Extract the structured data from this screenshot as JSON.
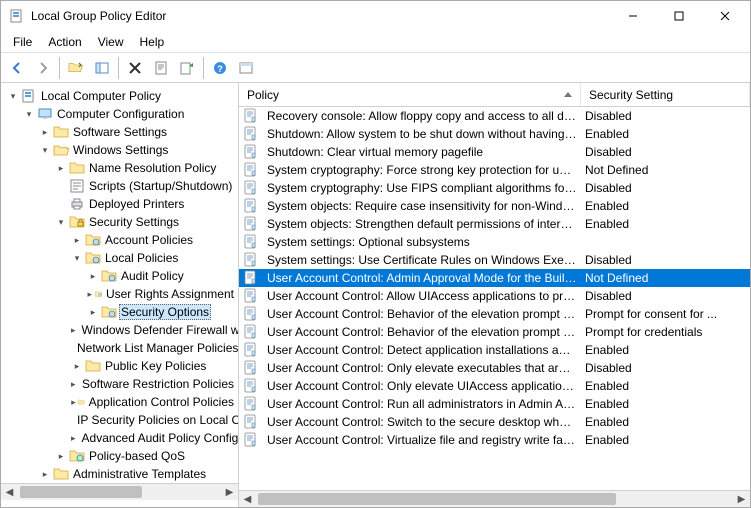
{
  "window": {
    "title": "Local Group Policy Editor",
    "menus": [
      "File",
      "Action",
      "View",
      "Help"
    ]
  },
  "tree": {
    "root": "Local Computer Policy",
    "cc": "Computer Configuration",
    "ss": "Software Settings",
    "ws": "Windows Settings",
    "nrp": "Name Resolution Policy",
    "scr": "Scripts (Startup/Shutdown)",
    "dp": "Deployed Printers",
    "secset": "Security Settings",
    "acct": "Account Policies",
    "local": "Local Policies",
    "audit": "Audit Policy",
    "ura": "User Rights Assignment",
    "seco": "Security Options",
    "wdf": "Windows Defender Firewall with Advanced Security",
    "nlm": "Network List Manager Policies",
    "pkp": "Public Key Policies",
    "srp": "Software Restriction Policies",
    "acp": "Application Control Policies",
    "ips": "IP Security Policies on Local Computer",
    "aap": "Advanced Audit Policy Configuration",
    "qos": "Policy-based QoS",
    "at": "Administrative Templates"
  },
  "columns": {
    "policy": "Policy",
    "setting": "Security Setting"
  },
  "policies": [
    {
      "name": "Recovery console: Allow floppy copy and access to all drives...",
      "setting": "Disabled"
    },
    {
      "name": "Shutdown: Allow system to be shut down without having to...",
      "setting": "Enabled"
    },
    {
      "name": "Shutdown: Clear virtual memory pagefile",
      "setting": "Disabled"
    },
    {
      "name": "System cryptography: Force strong key protection for user k...",
      "setting": "Not Defined"
    },
    {
      "name": "System cryptography: Use FIPS compliant algorithms for en...",
      "setting": "Disabled"
    },
    {
      "name": "System objects: Require case insensitivity for non-Windows ...",
      "setting": "Enabled"
    },
    {
      "name": "System objects: Strengthen default permissions of internal s...",
      "setting": "Enabled"
    },
    {
      "name": "System settings: Optional subsystems",
      "setting": ""
    },
    {
      "name": "System settings: Use Certificate Rules on Windows Executab...",
      "setting": "Disabled"
    },
    {
      "name": "User Account Control: Admin Approval Mode for the Built-i...",
      "setting": "Not Defined",
      "selected": true
    },
    {
      "name": "User Account Control: Allow UIAccess applications to prom...",
      "setting": "Disabled"
    },
    {
      "name": "User Account Control: Behavior of the elevation prompt for ...",
      "setting": "Prompt for consent for ..."
    },
    {
      "name": "User Account Control: Behavior of the elevation prompt for ...",
      "setting": "Prompt for credentials"
    },
    {
      "name": "User Account Control: Detect application installations and p...",
      "setting": "Enabled"
    },
    {
      "name": "User Account Control: Only elevate executables that are sig...",
      "setting": "Disabled"
    },
    {
      "name": "User Account Control: Only elevate UIAccess applications th...",
      "setting": "Enabled"
    },
    {
      "name": "User Account Control: Run all administrators in Admin Appr...",
      "setting": "Enabled"
    },
    {
      "name": "User Account Control: Switch to the secure desktop when pr...",
      "setting": "Enabled"
    },
    {
      "name": "User Account Control: Virtualize file and registry write failure...",
      "setting": "Enabled"
    }
  ]
}
